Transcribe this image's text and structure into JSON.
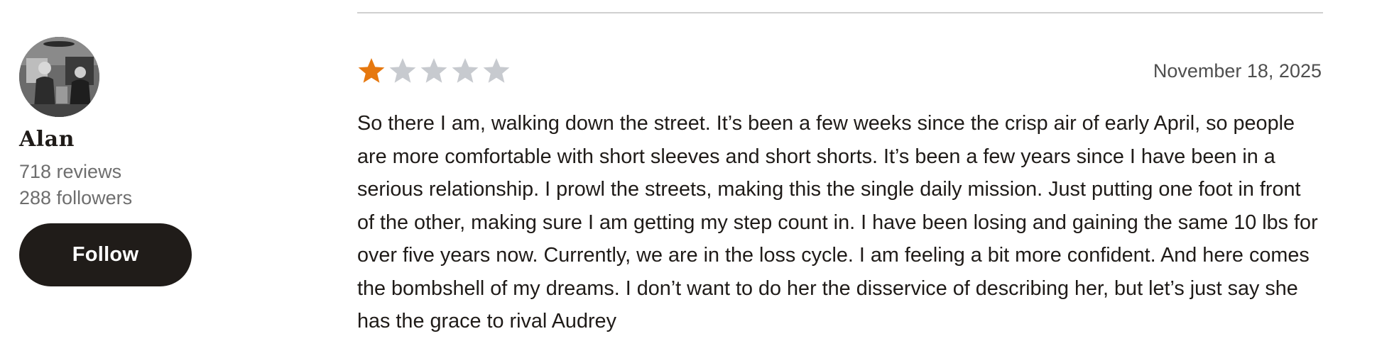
{
  "reviewer": {
    "name": "Alan",
    "reviews": "718 reviews",
    "followers": "288 followers",
    "follow_label": "Follow"
  },
  "review": {
    "rating": 1,
    "max_rating": 5,
    "date": "November 18, 2025",
    "text": "So there I am, walking down the street. It’s been a few weeks since the crisp air of early April, so people are more comfortable with short sleeves and short shorts. It’s been a few years since I have been in a serious relationship. I prowl the streets, making this the single daily mission. Just putting one foot in front of the other, making sure I am getting my step count in. I have been losing and gaining the same 10 lbs for over five years now. Currently, we are in the loss cycle. I am feeling a bit more confident. And here comes the bombshell of my dreams. I don’t want to do her the disservice of describing her, but let’s just say she has the grace to rival Audrey"
  },
  "colors": {
    "star_filled": "#e6780f",
    "star_empty": "#c7cacf",
    "follow_bg": "#201c19"
  },
  "icons": {
    "avatar": "user-photo",
    "star": "star-icon"
  }
}
